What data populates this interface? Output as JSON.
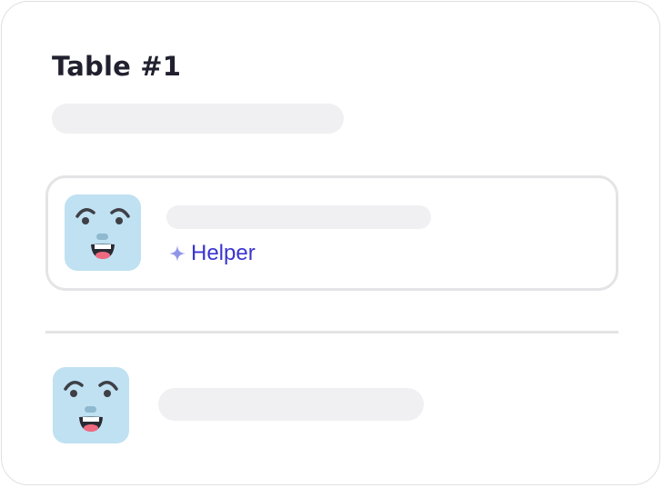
{
  "card": {
    "title": "Table #1"
  },
  "rows": [
    {
      "avatar_icon": "smiling-face-icon",
      "tag_icon": "sparkle-icon",
      "tag_label": "Helper",
      "selected": true
    },
    {
      "avatar_icon": "smiling-face-icon",
      "selected": false
    }
  ],
  "colors": {
    "title": "#21202f",
    "accent": "#3a35cf",
    "avatar_bg": "#bfe1f2",
    "skeleton": "#f0f0f2",
    "border": "#e4e4e6"
  }
}
